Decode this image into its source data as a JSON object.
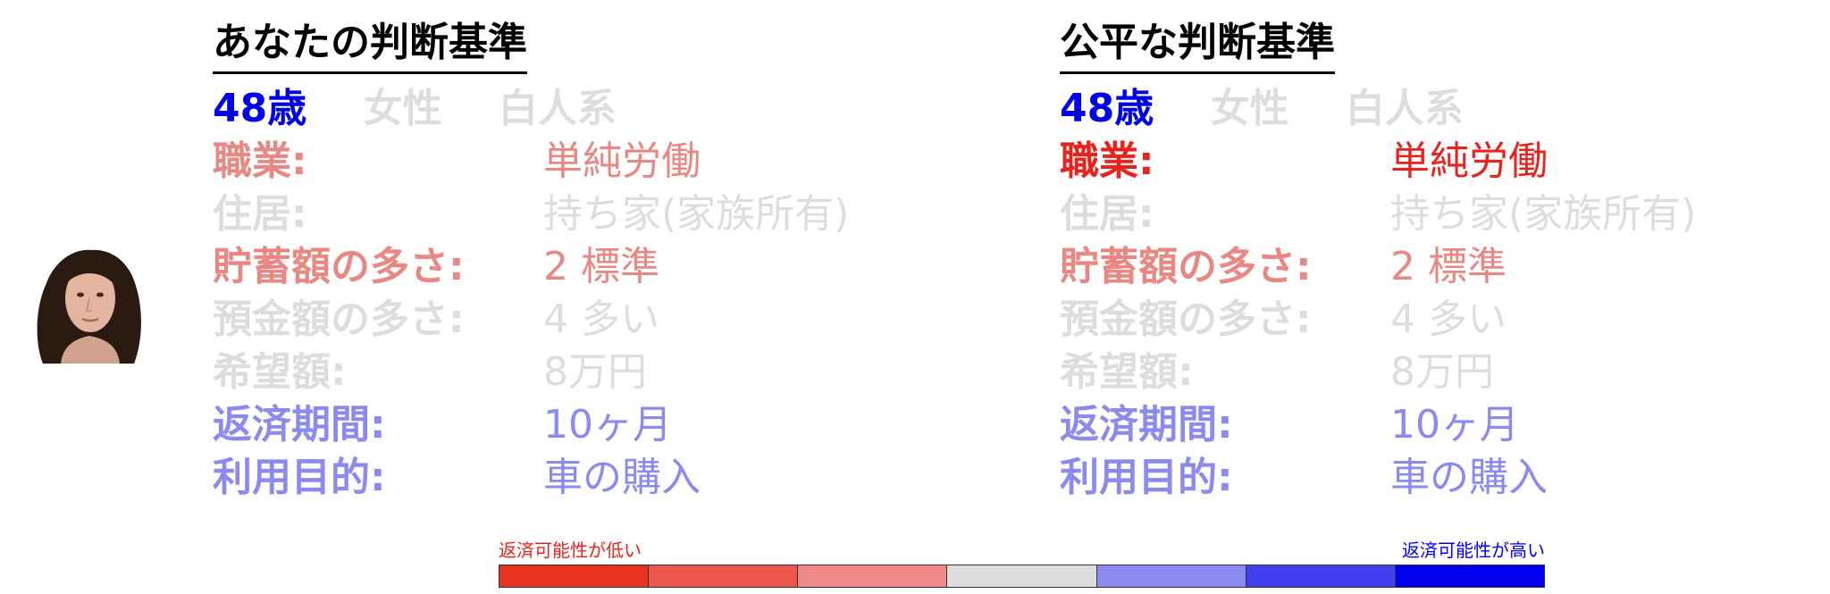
{
  "colors": {
    "blue": "#0000e6",
    "light_gray": "#dddddd",
    "red_light": "#e98882",
    "blue_light": "#8a8af0",
    "red_strong": "#e8231d"
  },
  "panels": [
    {
      "title": "あなたの判断基準",
      "demographics": [
        {
          "text": "48歳",
          "color": "#0000e6"
        },
        {
          "text": "女性",
          "color": "#dddddd"
        },
        {
          "text": "白人系",
          "color": "#dddddd"
        }
      ],
      "rows": [
        {
          "label": "職業:",
          "value": "単純労働",
          "color": "#e98882"
        },
        {
          "label": "住居:",
          "value": "持ち家(家族所有)",
          "color": "#dddddd"
        },
        {
          "label": "貯蓄額の多さ:",
          "value": "2 標準",
          "color": "#e98882"
        },
        {
          "label": "預金額の多さ:",
          "value": "4 多い",
          "color": "#dddddd"
        },
        {
          "label": "希望額:",
          "value": "8万円",
          "color": "#dddddd"
        },
        {
          "label": "返済期間:",
          "value": "10ヶ月",
          "color": "#8a8af0"
        },
        {
          "label": "利用目的:",
          "value": "車の購入",
          "color": "#8a8af0"
        }
      ]
    },
    {
      "title": "公平な判断基準",
      "demographics": [
        {
          "text": "48歳",
          "color": "#0000e6"
        },
        {
          "text": "女性",
          "color": "#dddddd"
        },
        {
          "text": "白人系",
          "color": "#dddddd"
        }
      ],
      "rows": [
        {
          "label": "職業:",
          "value": "単純労働",
          "color": "#e8231d"
        },
        {
          "label": "住居:",
          "value": "持ち家(家族所有)",
          "color": "#dddddd"
        },
        {
          "label": "貯蓄額の多さ:",
          "value": "2 標準",
          "color": "#e98882"
        },
        {
          "label": "預金額の多さ:",
          "value": "4 多い",
          "color": "#dddddd"
        },
        {
          "label": "希望額:",
          "value": "8万円",
          "color": "#dddddd"
        },
        {
          "label": "返済期間:",
          "value": "10ヶ月",
          "color": "#8a8af0"
        },
        {
          "label": "利用目的:",
          "value": "車の購入",
          "color": "#8a8af0"
        }
      ]
    }
  ],
  "legend": {
    "low_label": "返済可能性が低い",
    "high_label": "返済可能性が高い",
    "scale_colors": [
      "#e8321f",
      "#eb574d",
      "#ee8986",
      "#dddddd",
      "#8a8af0",
      "#4040f0",
      "#0000ee"
    ]
  }
}
